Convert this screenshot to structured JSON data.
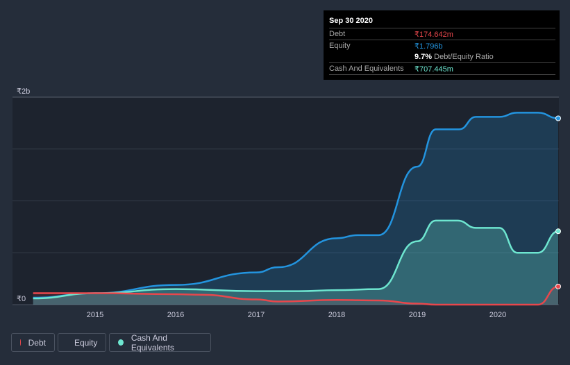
{
  "tooltip": {
    "date": "Sep 30 2020",
    "debt_label": "Debt",
    "debt_value": "₹174.642m",
    "equity_label": "Equity",
    "equity_value": "₹1.796b",
    "ratio_value": "9.7%",
    "ratio_label": "Debt/Equity Ratio",
    "cash_label": "Cash And Equivalents",
    "cash_value": "₹707.445m"
  },
  "legend": [
    {
      "label": "Debt",
      "color": "#e8474c"
    },
    {
      "label": "Equity",
      "color": "#2394df"
    },
    {
      "label": "Cash And Equivalents",
      "color": "#6ee6d0"
    }
  ],
  "chart_data": {
    "type": "area",
    "title": "",
    "xlabel": "",
    "ylabel": "",
    "ylim": [
      0,
      2
    ],
    "y_unit": "₹ billions",
    "y_ticks": [
      {
        "value": 0,
        "label": "₹0"
      },
      {
        "value": 2,
        "label": "₹2b"
      }
    ],
    "x_ticks": [
      2015,
      2016,
      2017,
      2018,
      2019,
      2020
    ],
    "xlim": [
      2014.03,
      2020.77
    ],
    "series": [
      {
        "name": "Equity",
        "color": "#2394df",
        "x": [
          2014.23,
          2015.0,
          2016.0,
          2017.0,
          2017.27,
          2018.0,
          2018.26,
          2018.52,
          2019.0,
          2019.23,
          2019.52,
          2019.73,
          2020.02,
          2020.24,
          2020.5,
          2020.75
        ],
        "y": [
          0.067,
          0.11,
          0.19,
          0.31,
          0.36,
          0.64,
          0.67,
          0.67,
          1.33,
          1.69,
          1.69,
          1.81,
          1.81,
          1.85,
          1.85,
          1.796
        ]
      },
      {
        "name": "Cash And Equivalents",
        "color": "#6ee6d0",
        "x": [
          2014.23,
          2015.0,
          2016.0,
          2017.0,
          2017.53,
          2018.0,
          2018.52,
          2019.0,
          2019.23,
          2019.5,
          2019.73,
          2020.02,
          2020.24,
          2020.5,
          2020.75
        ],
        "y": [
          0.06,
          0.11,
          0.15,
          0.13,
          0.13,
          0.14,
          0.15,
          0.61,
          0.81,
          0.81,
          0.74,
          0.74,
          0.5,
          0.5,
          0.707
        ]
      },
      {
        "name": "Debt",
        "color": "#e8474c",
        "x": [
          2014.23,
          2015.0,
          2016.0,
          2016.32,
          2017.0,
          2017.27,
          2018.0,
          2018.52,
          2019.0,
          2019.23,
          2020.5,
          2020.75
        ],
        "y": [
          0.11,
          0.11,
          0.1,
          0.095,
          0.05,
          0.03,
          0.045,
          0.04,
          0.01,
          0.0,
          0.0,
          0.175
        ]
      }
    ]
  }
}
